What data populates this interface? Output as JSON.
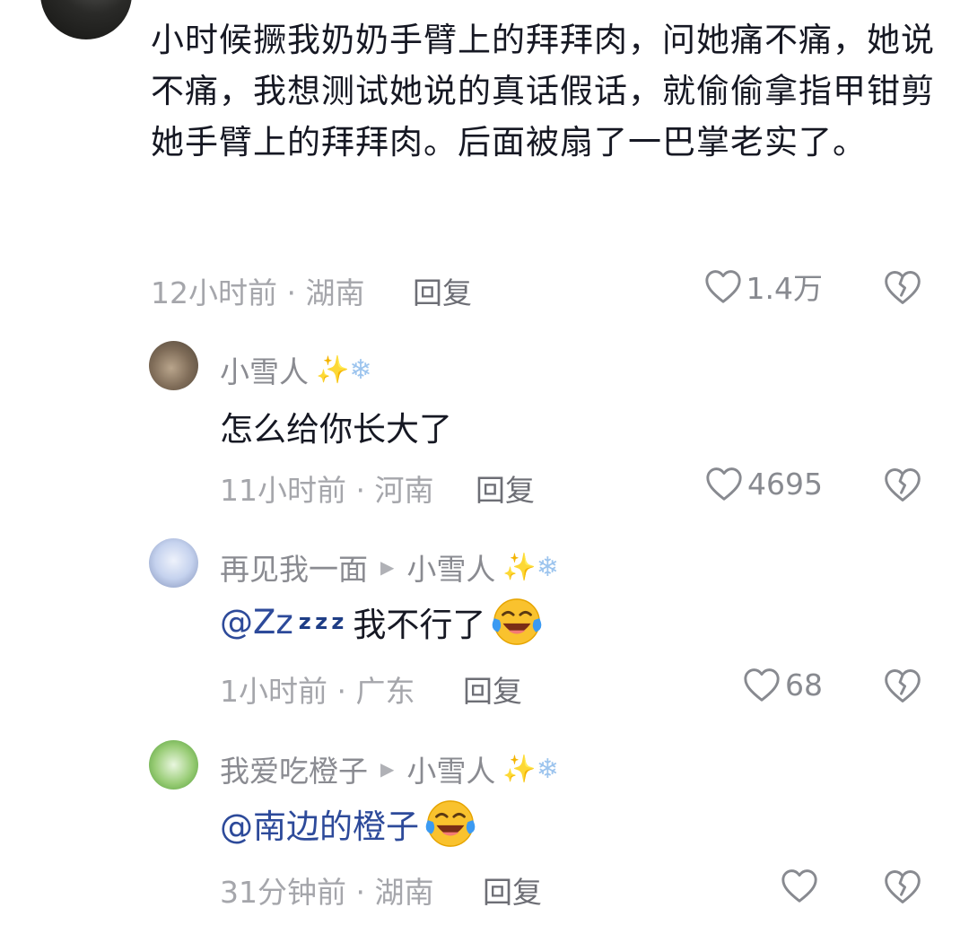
{
  "comment": {
    "text": "小时候撅我奶奶手臂上的拜拜肉，问她痛不痛，她说不痛，我想测试她说的真话假话，就偷偷拿指甲钳剪她手臂上的拜拜肉。后面被扇了一巴掌老实了。",
    "time": "12小时前",
    "location": "湖南",
    "reply_label": "回复",
    "likes": "1.4万"
  },
  "replies": [
    {
      "username": "小雪人",
      "name_emoji_1": "✨",
      "name_emoji_2": "❄",
      "text": "怎么给你长大了",
      "time": "11小时前",
      "location": "河南",
      "reply_label": "回复",
      "likes": "4695"
    },
    {
      "username": "再见我一面",
      "reply_to": "小雪人",
      "name_emoji_1": "✨",
      "name_emoji_2": "❄",
      "mention": "@Zz",
      "mention_icon": "z z z",
      "text": "我不行了",
      "emoji": "laughing-crying-emoji",
      "time": "1小时前",
      "location": "广东",
      "reply_label": "回复",
      "likes": "68"
    },
    {
      "username": "我爱吃橙子",
      "reply_to": "小雪人",
      "name_emoji_1": "✨",
      "name_emoji_2": "❄",
      "mention": "@南边的橙子",
      "emoji": "laughing-crying-emoji",
      "time": "31分钟前",
      "location": "湖南",
      "reply_label": "回复",
      "likes": ""
    }
  ],
  "separator": " · ",
  "colors": {
    "text": "#161823",
    "meta": "#a5a6ab",
    "mention": "#2d4a9a",
    "icon": "#8a8b91"
  },
  "icons": {
    "like": "heart-outline-icon",
    "dislike": "broken-heart-icon",
    "reply_to": "play-triangle-icon"
  }
}
